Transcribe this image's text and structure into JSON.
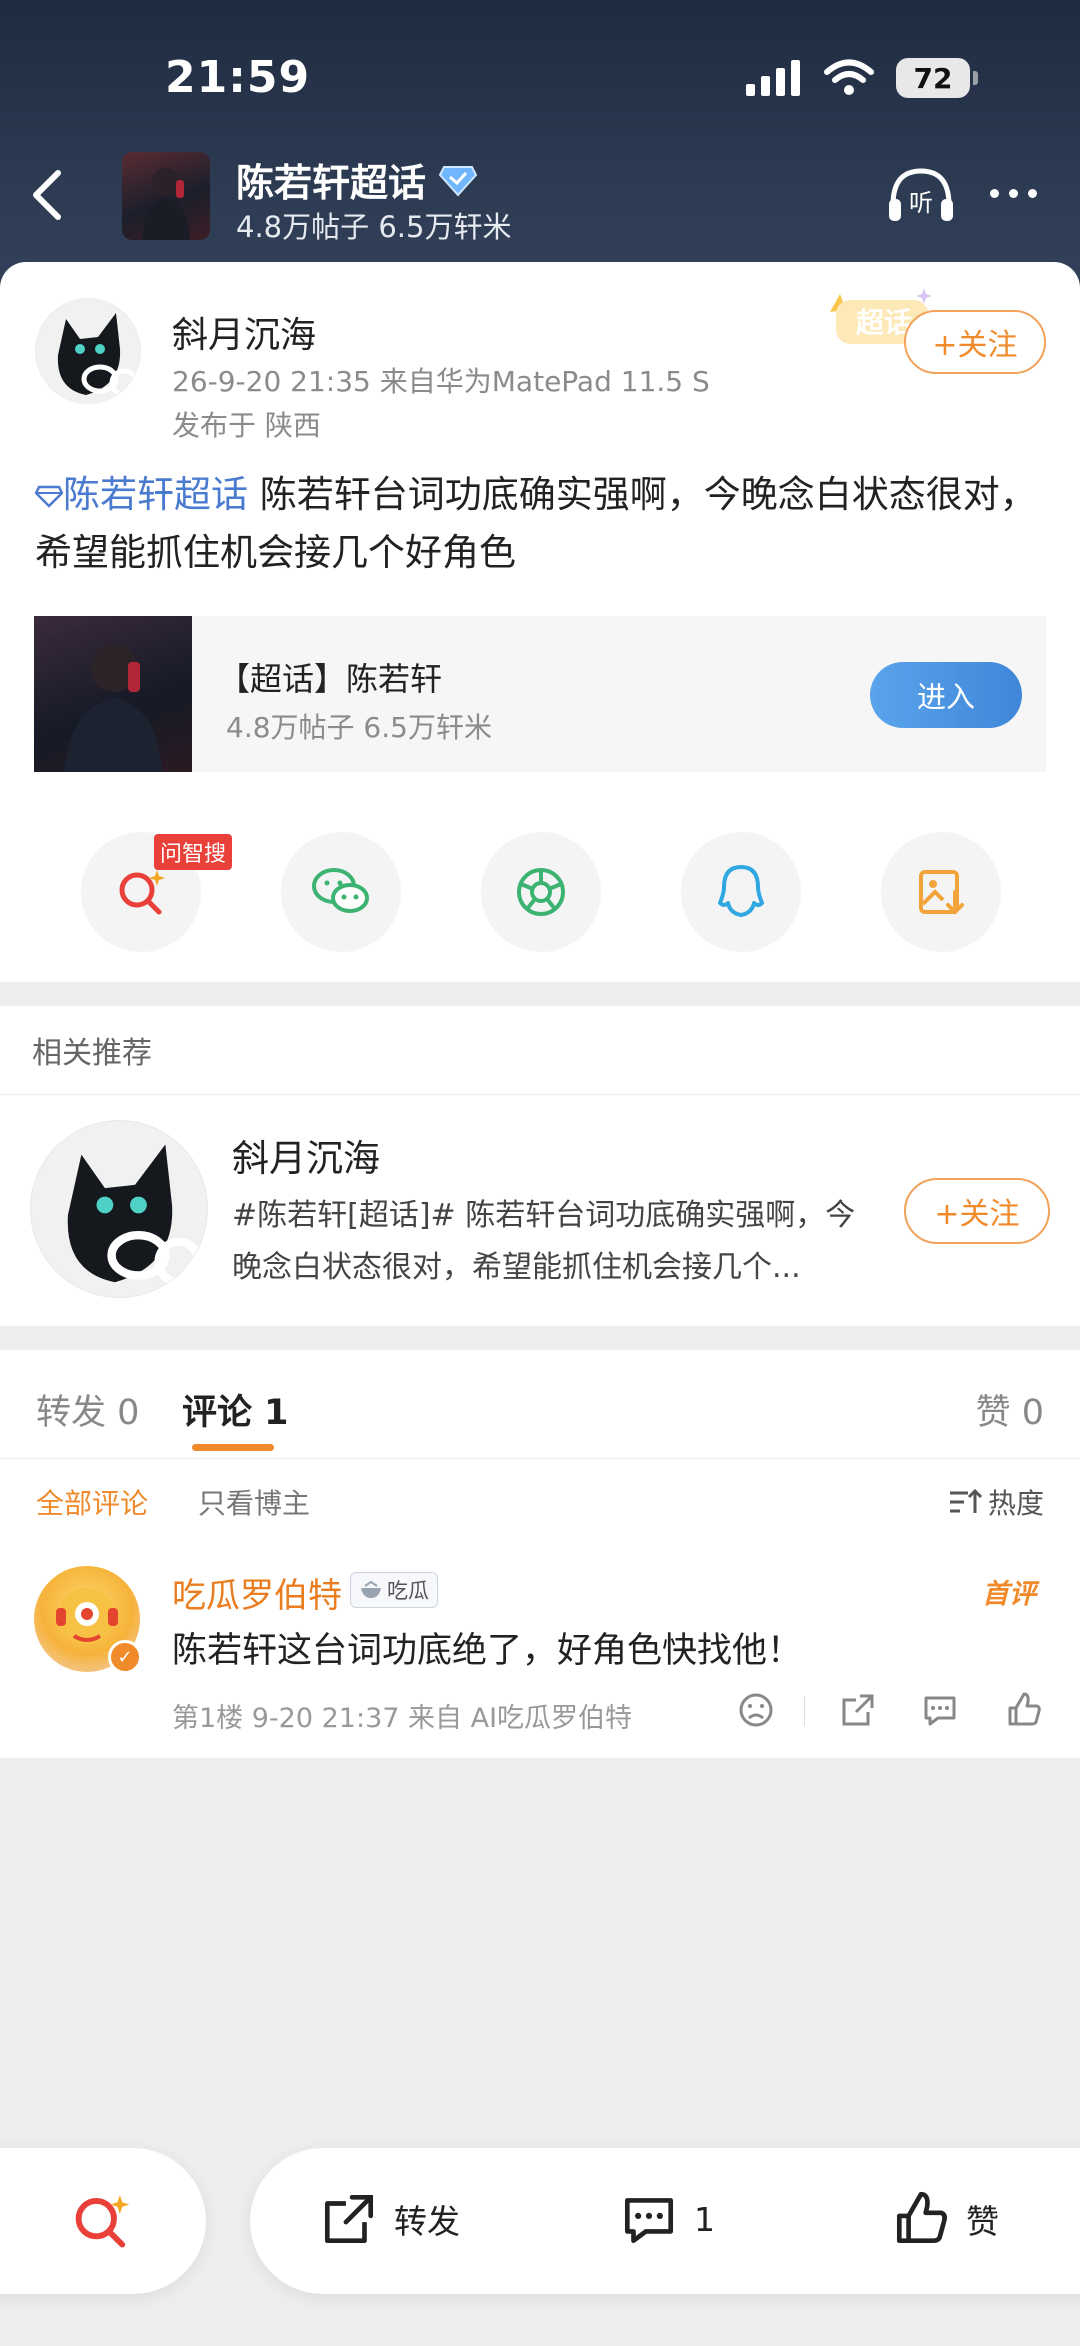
{
  "status_bar": {
    "time": "21:59",
    "battery": "72"
  },
  "header": {
    "topic_title": "陈若轩超话",
    "topic_stats": "4.8万帖子 6.5万轩米",
    "listen_label": "听"
  },
  "post": {
    "author": "斜月沉海",
    "meta": "26-9-20 21:35  来自华为MatePad 11.5 S",
    "location": "发布于 陕西",
    "badge": "超话",
    "follow_label": "+关注",
    "topic_link": "陈若轩超话",
    "text": " 陈若轩台词功底确实强啊，今晚念白状态很对，希望能抓住机会接几个好角色",
    "topic_card": {
      "title": "【超话】陈若轩",
      "stats": "4.8万帖子 6.5万轩米",
      "enter_label": "进入"
    },
    "share": {
      "wzs_tag": "问智搜"
    }
  },
  "related": {
    "heading": "相关推荐",
    "name": "斜月沉海",
    "text": "#陈若轩[超话]#  陈若轩台词功底确实强啊，今晚念白状态很对，希望能抓住机会接几个...",
    "follow_label": "+关注"
  },
  "tabs": {
    "repost": "转发 0",
    "comment": "评论 1",
    "like": "赞 0"
  },
  "filters": {
    "all": "全部评论",
    "author_only": "只看博主",
    "sort": "热度"
  },
  "comment": {
    "name": "吃瓜罗伯特",
    "tag": "吃瓜",
    "first_label": "首评",
    "text": "陈若轩这台词功底绝了，好角色快找他！",
    "meta": "第1楼 9-20 21:37  来自 AI吃瓜罗伯特"
  },
  "bottom_bar": {
    "repost": "转发",
    "comment_count": "1",
    "like": "赞"
  },
  "colors": {
    "accent_orange": "#f08a2b",
    "link_blue": "#4a7bd0",
    "enter_blue": "#3f86d9"
  }
}
